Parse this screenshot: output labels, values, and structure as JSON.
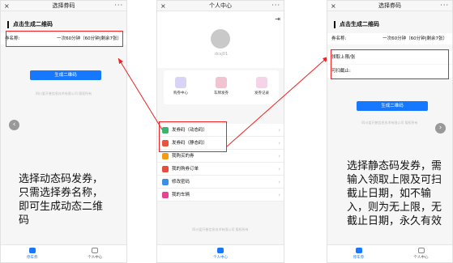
{
  "left_phone": {
    "title": "选择券码",
    "section_title": "点击生成二维码",
    "coupon_label": "券名称:",
    "coupon_value": "一次60分钟（60分钟|剩余7张）",
    "generate_button": "生成二维码",
    "copyright": "四川爱开普信息技术有限公司 版权所有",
    "tabs": [
      "停车券",
      "个人中心"
    ],
    "annotation": "选择动态码发券，只需选择券名称，即可生成动态二维码"
  },
  "middle_phone": {
    "title": "个人中心",
    "username": "dcsj01",
    "quick": [
      "购券中心",
      "车牌发券",
      "发券记录"
    ],
    "menu": [
      "发券码（动态码）",
      "发券码（静态码）",
      "我购买的券",
      "我的购券订单",
      "修改密码",
      "我的车辆"
    ],
    "copyright": "四川爱开普信息技术有限公司 版权所有",
    "tab_label": "个人中心"
  },
  "right_phone": {
    "title": "选择券码",
    "section_title": "点击生成二维码",
    "coupon_label": "券名称:",
    "coupon_value": "一次60分钟（60分钟|剩余7张）",
    "limit_label": "领取上限/张",
    "deadline_label": "可扫截止:",
    "generate_button": "生成二维码",
    "copyright": "四川爱开普信息技术有限公司 版权所有",
    "tabs": [
      "停车券",
      "个人中心"
    ],
    "annotation": "选择静态码发券，需输入领取上限及可扫截止日期，如不输入，则为无上限，无截止日期，永久有效"
  },
  "colors": {
    "accent": "#1677ff",
    "highlight": "#ee2222"
  }
}
